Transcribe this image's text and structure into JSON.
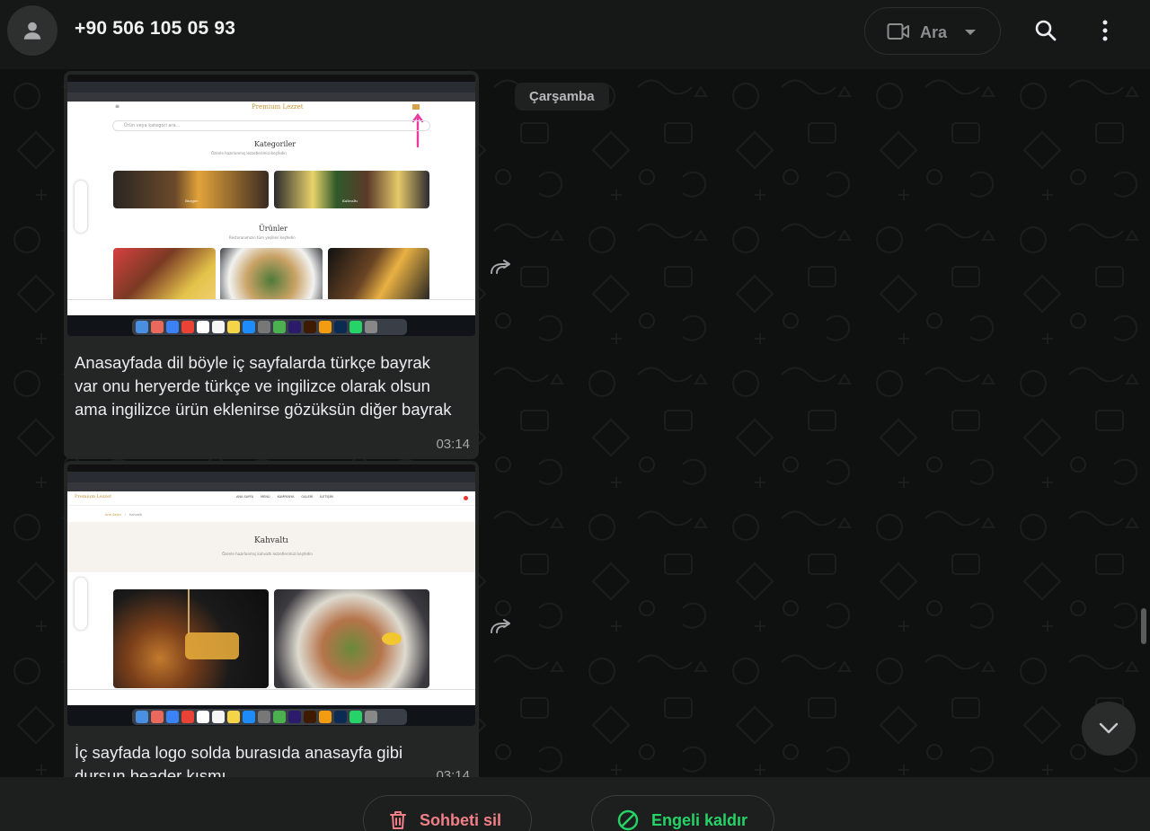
{
  "header": {
    "contact_name": "+90 506 105 05 93",
    "call_label": "Ara",
    "icons": [
      "default-avatar-icon",
      "video-camera-icon",
      "search-icon",
      "menu-icon"
    ]
  },
  "chat": {
    "day_label": "Çarşamba",
    "messages": [
      {
        "caption": "Anasayfada dil böyle iç sayfalarda türkçe bayrak var onu heryerde türkçe ve ingilizce olarak olsun ama ingilizce ürün eklenirse gözüksün diğer bayrak",
        "time": "03:14",
        "screenshot": {
          "brand": "Premium Lezzet",
          "search_placeholder": "Ürün veya kategori ara...",
          "section1": "Kategoriler",
          "section1_sub": "Özenle hazırlanmış lezzetlerimizi keşfedin",
          "cat1": "Burger",
          "cat2": "Kahvaltı",
          "section2": "Ürünler",
          "section2_sub": "Restoranımızın tüm yeşilleri keşfedin"
        }
      },
      {
        "caption": "İç sayfada logo solda burasıda anasayfa gibi dursun header kısmı",
        "time": "03:14",
        "screenshot": {
          "brand": "Premium Lezzet",
          "nav": [
            "ANA SAYFA",
            "MENÜ",
            "KAMPANYA",
            "GALERİ",
            "İLETİŞİM"
          ],
          "breadcrumb_home": "Ana Sayfa",
          "breadcrumb_current": "Kahvaltı",
          "title": "Kahvaltı",
          "subtitle": "Özenle hazırlanmış kahvaltı lezzetlerimizi keşfedin"
        }
      }
    ]
  },
  "footer": {
    "delete_label": "Sohbeti sil",
    "unblock_label": "Engeli kaldır"
  },
  "colors": {
    "delete": "#f17f87",
    "unblock": "#25d366",
    "bubble": "#242626"
  }
}
